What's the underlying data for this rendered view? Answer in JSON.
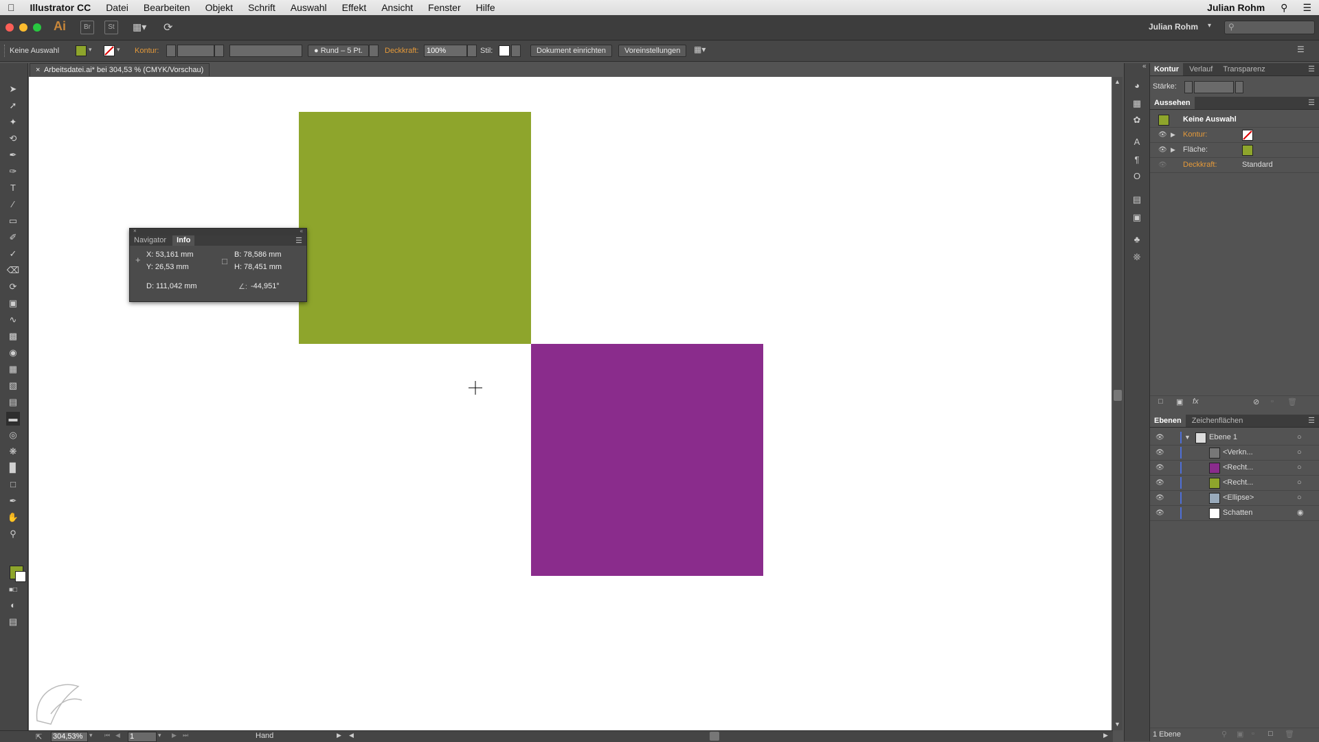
{
  "menubar": {
    "app_name": "Illustrator CC",
    "items": [
      "Datei",
      "Bearbeiten",
      "Objekt",
      "Schrift",
      "Auswahl",
      "Effekt",
      "Ansicht",
      "Fenster",
      "Hilfe"
    ],
    "user": "Julian Rohm"
  },
  "appbar": {
    "logo": "Ai",
    "bridge": "Br",
    "stock": "St",
    "user_menu": "Julian Rohm"
  },
  "control": {
    "selection": "Keine Auswahl",
    "stroke_label": "Kontur:",
    "brush": "Rund – 5 Pt.",
    "opacity_label": "Deckkraft:",
    "opacity_value": "100%",
    "style_label": "Stil:",
    "doc_setup": "Dokument einrichten",
    "prefs": "Voreinstellungen"
  },
  "document": {
    "tab_title": "Arbeitsdatei.ai* bei 304,53 % (CMYK/Vorschau)"
  },
  "status": {
    "zoom": "304,53%",
    "page": "1",
    "tool": "Hand"
  },
  "info_panel": {
    "tab_navigator": "Navigator",
    "tab_info": "Info",
    "x": "X:  53,161 mm",
    "y": "Y:  26,53 mm",
    "w": "B:   78,586 mm",
    "h": "H:  78,451 mm",
    "d": "D:  111,042 mm",
    "angle": "-44,951°"
  },
  "panel_stroke": {
    "tabs": [
      "Kontur",
      "Verlauf",
      "Transparenz"
    ],
    "weight_label": "Stärke:"
  },
  "panel_appearance": {
    "title": "Aussehen",
    "no_selection": "Keine Auswahl",
    "stroke": "Kontur:",
    "fill": "Fläche:",
    "opacity": "Deckkraft:",
    "opacity_value": "Standard"
  },
  "panel_layers": {
    "tabs": [
      "Ebenen",
      "Zeichenflächen"
    ],
    "layer": "Ebene 1",
    "items": [
      "<Verkn...",
      "<Recht...",
      "<Recht...",
      "<Ellipse>",
      "Schatten"
    ],
    "footer": "1 Ebene"
  },
  "colors": {
    "green": "#8ea52c",
    "purple": "#8a2c8c",
    "accent": "#e59a3a"
  }
}
